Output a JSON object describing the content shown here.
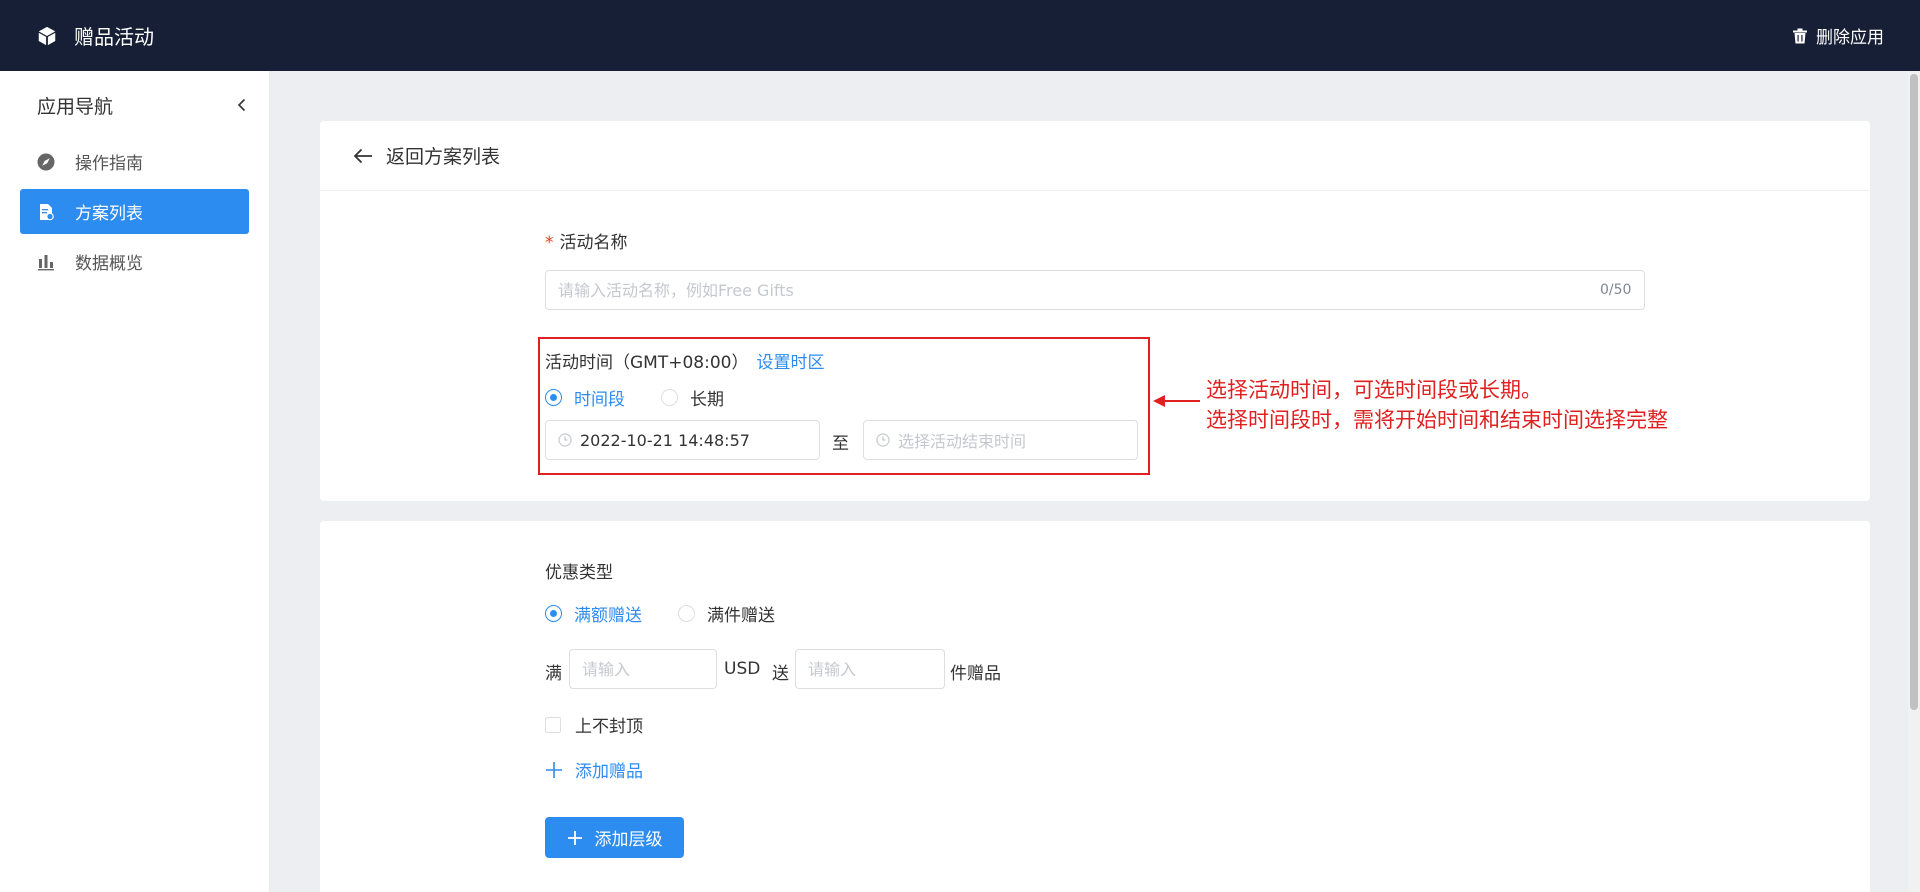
{
  "header": {
    "title": "赠品活动",
    "delete_label": "删除应用"
  },
  "sidebar": {
    "title": "应用导航",
    "items": [
      {
        "label": "操作指南"
      },
      {
        "label": "方案列表"
      },
      {
        "label": "数据概览"
      }
    ]
  },
  "card1": {
    "back_label": "返回方案列表",
    "name_label": "活动名称",
    "name_required": "*",
    "name_placeholder": "请输入活动名称，例如Free Gifts",
    "name_counter": "0/50",
    "time_label": "活动时间（GMT+08:00）",
    "timezone_link": "设置时区",
    "time_options": [
      "时间段",
      "长期"
    ],
    "start_time": "2022-10-21 14:48:57",
    "to_label": "至",
    "end_placeholder": "选择活动结束时间"
  },
  "annotation": {
    "line1": "选择活动时间，可选时间段或长期。",
    "line2": "选择时间段时，需将开始时间和结束时间选择完整"
  },
  "card2": {
    "type_label": "优惠类型",
    "type_options": [
      "满额赠送",
      "满件赠送"
    ],
    "full_label": "满",
    "amount_placeholder": "请输入",
    "currency": "USD",
    "give_label": "送",
    "count_placeholder": "请输入",
    "gift_suffix": "件赠品",
    "no_cap_label": "上不封顶",
    "add_gift": "添加赠品",
    "add_tier": "添加层级"
  },
  "colors": {
    "header_bg": "#161f35",
    "primary": "#2d8cf0",
    "annotation": "#e02020"
  }
}
